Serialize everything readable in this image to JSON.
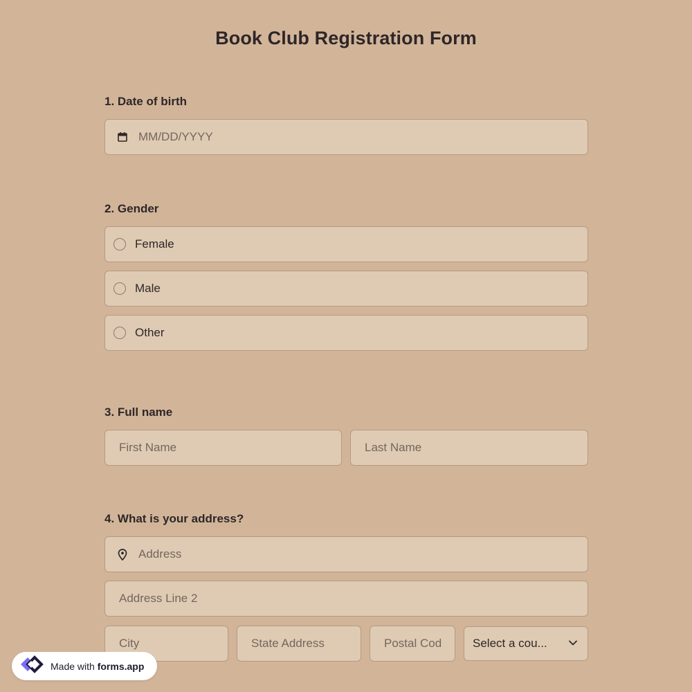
{
  "form": {
    "title": "Book Club Registration Form"
  },
  "questions": {
    "dob": {
      "label": "1.  Date of birth",
      "placeholder": "MM/DD/YYYY",
      "icon": "calendar-icon"
    },
    "gender": {
      "label": "2. Gender",
      "options": [
        "Female",
        "Male",
        "Other"
      ]
    },
    "full_name": {
      "label": "3. Full name",
      "first_placeholder": "First Name",
      "last_placeholder": "Last Name"
    },
    "address": {
      "label": "4. What is your address?",
      "address_placeholder": "Address",
      "address_icon": "map-pin-icon",
      "line2_placeholder": "Address Line 2",
      "city_placeholder": "City",
      "state_placeholder": "State Address",
      "postal_placeholder": "Postal Cod",
      "country_value": "Select a cou...",
      "country_icon": "chevron-down-icon"
    }
  },
  "badge": {
    "prefix": "Made with ",
    "brand": "forms.app",
    "icon": "forms-app-logo-icon"
  },
  "colors": {
    "background": "#d2b599",
    "field_background": "#dfcbb3",
    "field_border": "#b49a82",
    "text": "#2e2628",
    "logo_purple": "#7b6cf6",
    "logo_dark": "#1f1b3a"
  }
}
